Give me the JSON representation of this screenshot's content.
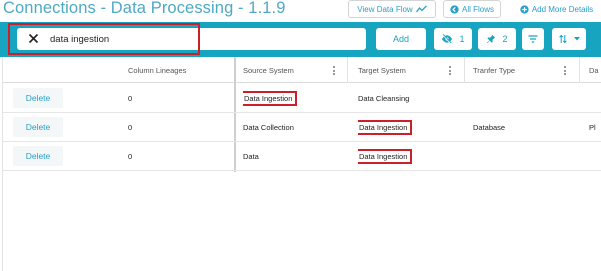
{
  "header": {
    "title": "Connections - Data Processing - 1.1.9",
    "view_data_flow": "View Data Flow",
    "all_flows": "All Flows",
    "add_more_details": "Add More Details"
  },
  "search": {
    "value": "data ingestion",
    "add_label": "Add",
    "hidden_count": "1",
    "pinned_count": "2"
  },
  "grid": {
    "columns": [
      "",
      "Column Lineages",
      "Source System",
      "Target System",
      "Tranfer Type",
      "Da"
    ],
    "rows": [
      {
        "action": "Delete",
        "lineages": "0",
        "source": "Data Ingestion",
        "target": "Data Cleansing",
        "transfer": "",
        "extra": ""
      },
      {
        "action": "Delete",
        "lineages": "0",
        "source": "Data Collection",
        "target": "Data Ingestion",
        "transfer": "Database",
        "extra": "Pl"
      },
      {
        "action": "Delete",
        "lineages": "0",
        "source": "Data",
        "target": "Data Ingestion",
        "transfer": "",
        "extra": ""
      }
    ]
  },
  "colors": {
    "toolbar": "#17a4c1",
    "title": "#4fa9c4",
    "highlight": "#cc1f2a",
    "link": "#2a9fc8"
  },
  "icons": [
    "trend-line-icon",
    "circle-arrow-left-icon",
    "plus-circle-icon",
    "close-icon",
    "eye-slash-icon",
    "pin-icon",
    "filter-icon",
    "sort-icon",
    "caret-down-icon",
    "column-menu-icon"
  ]
}
